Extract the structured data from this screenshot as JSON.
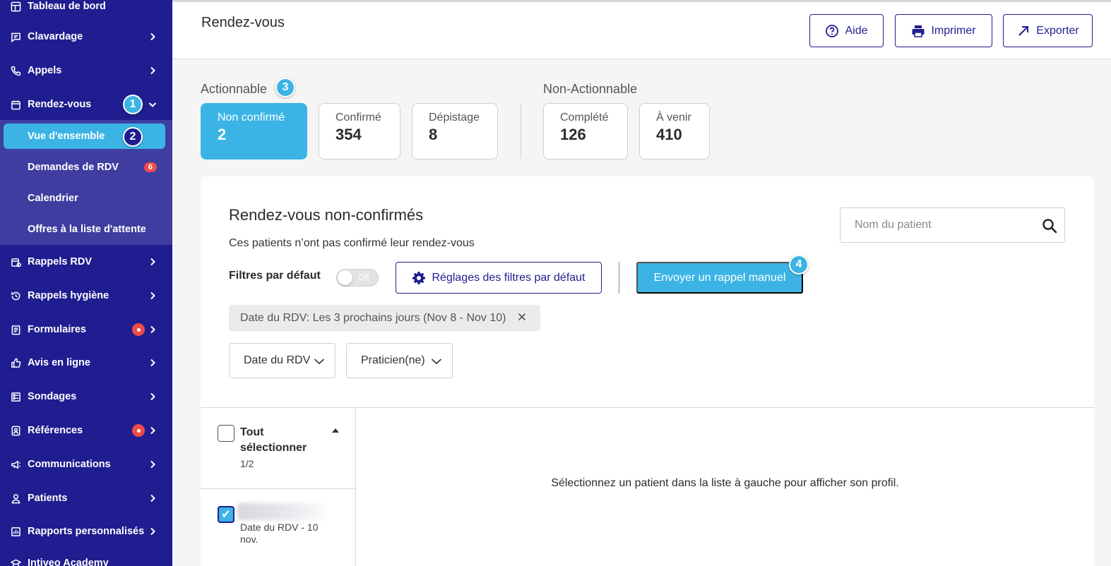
{
  "sidebar": {
    "items": [
      {
        "label": "Tableau de bord",
        "icon": "dashboard-icon"
      },
      {
        "label": "Clavardage",
        "icon": "chat-icon"
      },
      {
        "label": "Appels",
        "icon": "phone-icon"
      },
      {
        "label": "Rendez-vous",
        "icon": "calendar-icon"
      },
      {
        "label": "Rappels RDV",
        "icon": "calendar-reminder-icon"
      },
      {
        "label": "Rappels hygiène",
        "icon": "history-icon"
      },
      {
        "label": "Formulaires",
        "icon": "form-icon"
      },
      {
        "label": "Avis en ligne",
        "icon": "thumbs-up-icon"
      },
      {
        "label": "Sondages",
        "icon": "survey-icon"
      },
      {
        "label": "Références",
        "icon": "referral-icon"
      },
      {
        "label": "Communications",
        "icon": "megaphone-icon"
      },
      {
        "label": "Patients",
        "icon": "person-icon"
      },
      {
        "label": "Rapports personnalisés",
        "icon": "report-icon"
      },
      {
        "label": "Intiveo Academy",
        "icon": "academy-icon"
      }
    ],
    "subitems": [
      {
        "label": "Vue d'ensemble",
        "active": true
      },
      {
        "label": "Demandes de RDV",
        "badge": "6"
      },
      {
        "label": "Calendrier"
      },
      {
        "label": "Offres à la liste d'attente"
      }
    ],
    "steps": {
      "one": "1",
      "two": "2"
    }
  },
  "header": {
    "title": "Rendez-vous",
    "help_label": "Aide",
    "print_label": "Imprimer",
    "export_label": "Exporter"
  },
  "stats": {
    "actionable_label": "Actionnable",
    "nonactionable_label": "Non-Actionnable",
    "step_three": "3",
    "actionable": [
      {
        "label": "Non confirmé",
        "value": "2",
        "active": true
      },
      {
        "label": "Confirmé",
        "value": "354"
      },
      {
        "label": "Dépistage",
        "value": "8"
      }
    ],
    "nonactionable": [
      {
        "label": "Complété",
        "value": "126"
      },
      {
        "label": "À venir",
        "value": "410"
      }
    ]
  },
  "card": {
    "title": "Rendez-vous non-confirmés",
    "subtitle": "Ces patients n’ont pas confirmé leur rendez-vous",
    "search_placeholder": "Nom du patient",
    "default_filters_label": "Filtres par défaut",
    "toggle_text": "Off",
    "settings_button": "Réglages des filtres par défaut",
    "send_button": "Envoyer un rappel manuel",
    "step_four": "4",
    "chip_text": "Date du RDV: Les 3 prochains jours (Nov 8 - Nov 10)",
    "dropdown_date": "Date du RDV",
    "dropdown_practitioner": "Praticien(ne)",
    "select_all": "Tout sélectionner",
    "select_count": "1/2",
    "row_date": "Date du RDV - 10 nov.",
    "empty_message": "Sélectionnez un patient dans la liste à gauche pour afficher son profil."
  },
  "colors": {
    "sidebar": "#1f1d8f",
    "accent": "#3bb4e5",
    "badge_red": "#ef4b4b"
  }
}
